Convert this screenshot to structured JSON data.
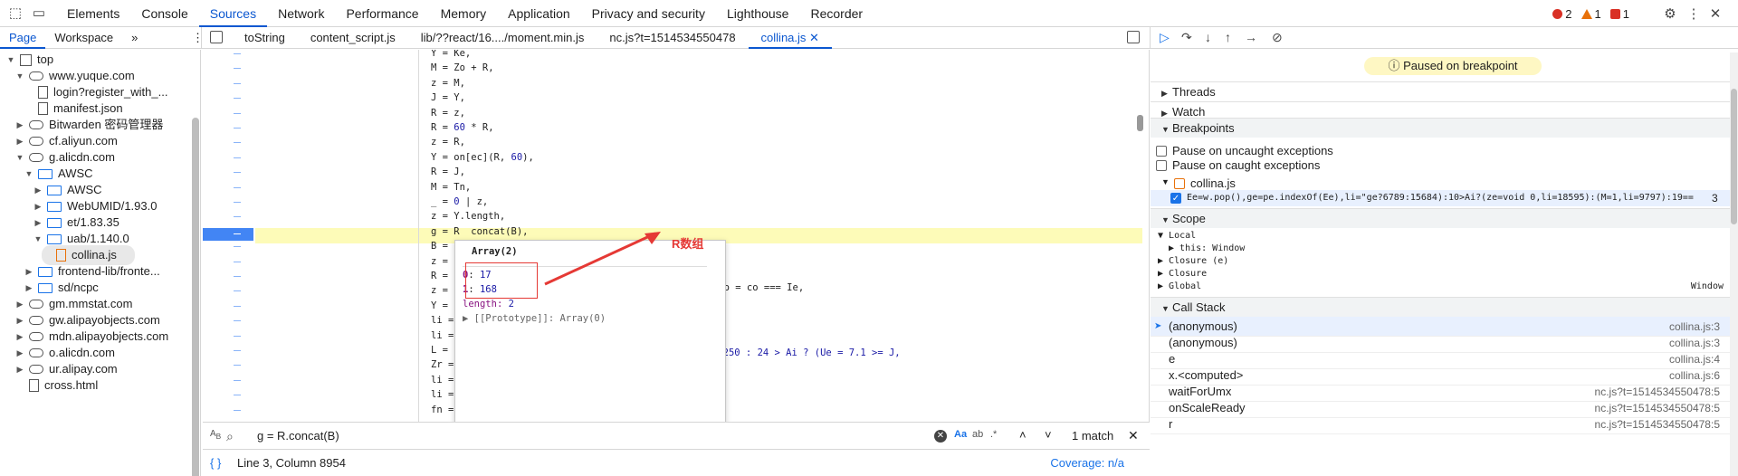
{
  "toolbar": {
    "tabs": [
      "Elements",
      "Console",
      "Sources",
      "Network",
      "Performance",
      "Memory",
      "Application",
      "Privacy and security",
      "Lighthouse",
      "Recorder"
    ],
    "errors": "2",
    "warnings": "1",
    "issues": "1"
  },
  "navigator": {
    "tabs": [
      "Page",
      "Workspace"
    ],
    "more": "»"
  },
  "file_tabs": [
    "toString",
    "content_script.js",
    "lib/??react/16..../moment.min.js",
    "nc.js?t=1514534550478",
    "collina.js"
  ],
  "tree": [
    {
      "label": "top",
      "indent": 0,
      "arrow": "▼",
      "icon": "top"
    },
    {
      "label": "www.yuque.com",
      "indent": 1,
      "arrow": "▼",
      "icon": "cloud"
    },
    {
      "label": "login?register_with_...",
      "indent": 2,
      "arrow": "",
      "icon": "file"
    },
    {
      "label": "manifest.json",
      "indent": 2,
      "arrow": "",
      "icon": "file"
    },
    {
      "label": "Bitwarden 密码管理器",
      "indent": 1,
      "arrow": "▶",
      "icon": "cloud"
    },
    {
      "label": "cf.aliyun.com",
      "indent": 1,
      "arrow": "▶",
      "icon": "cloud"
    },
    {
      "label": "g.alicdn.com",
      "indent": 1,
      "arrow": "▼",
      "icon": "cloud"
    },
    {
      "label": "AWSC",
      "indent": 2,
      "arrow": "▼",
      "icon": "folder"
    },
    {
      "label": "AWSC",
      "indent": 3,
      "arrow": "▶",
      "icon": "folder"
    },
    {
      "label": "WebUMID/1.93.0",
      "indent": 3,
      "arrow": "▶",
      "icon": "folder"
    },
    {
      "label": "et/1.83.35",
      "indent": 3,
      "arrow": "▶",
      "icon": "folder"
    },
    {
      "label": "uab/1.140.0",
      "indent": 3,
      "arrow": "▼",
      "icon": "folder"
    },
    {
      "label": "collina.js",
      "indent": 4,
      "arrow": "",
      "icon": "js",
      "selected": true
    },
    {
      "label": "frontend-lib/fronte...",
      "indent": 2,
      "arrow": "▶",
      "icon": "folder"
    },
    {
      "label": "sd/ncpc",
      "indent": 2,
      "arrow": "▶",
      "icon": "folder"
    },
    {
      "label": "gm.mmstat.com",
      "indent": 1,
      "arrow": "▶",
      "icon": "cloud"
    },
    {
      "label": "gw.alipayobjects.com",
      "indent": 1,
      "arrow": "▶",
      "icon": "cloud"
    },
    {
      "label": "mdn.alipayobjects.com",
      "indent": 1,
      "arrow": "▶",
      "icon": "cloud"
    },
    {
      "label": "o.alicdn.com",
      "indent": 1,
      "arrow": "▶",
      "icon": "cloud"
    },
    {
      "label": "ur.alipay.com",
      "indent": 1,
      "arrow": "▶",
      "icon": "cloud"
    },
    {
      "label": "cross.html",
      "indent": 1,
      "arrow": "",
      "icon": "file"
    }
  ],
  "code_lines": [
    "Y = Ke,",
    "M = Zo + R,",
    "z = M,",
    "J = Y,",
    "R = z,",
    "R = 60 * R,",
    "z = R,",
    "Y = on[ec](R, 60),",
    "R = J,",
    "M = Tn,",
    "_ = 0 | z,",
    "z = Y.length,",
    "g = R  concat(B),",
    "B =",
    "z =",
    "R =",
    "z =",
    "Y =",
    "li =",
    "li =",
    "L =",
    "Zr =",
    "li =",
    "li =",
    "fn ="
  ],
  "code_tail": {
    "line19": "(Jo = co === Ie,",
    "line23": "21250 : 24 > Ai ? (Ue = 7.1 >= J,"
  },
  "popup": {
    "title": "Array(2)",
    "item0_key": "0",
    "item0_val": "17",
    "item1_key": "1",
    "item1_val": "168",
    "length_key": "length",
    "length_val": "2",
    "proto": "[[Prototype]]: Array(0)"
  },
  "annotation": "R数组",
  "search": {
    "value": "g = R.concat(B)",
    "match_case": "Aa",
    "regex": ".*",
    "result": "1 match"
  },
  "status": {
    "position": "Line 3, Column 8954",
    "coverage": "Coverage: n/a"
  },
  "debugger": {
    "paused": "Paused on breakpoint",
    "threads": "Threads",
    "watch": "Watch",
    "breakpoints": "Breakpoints",
    "pause_uncaught": "Pause on uncaught exceptions",
    "pause_caught": "Pause on caught exceptions",
    "bp_file": "collina.js",
    "bp_code": "Ee=w.pop(),ge=pe.indexOf(Ee),li=\"ge?6789:15684):10>Ai?(ze=void 0,li=18595):(M=1,li=9797):19===",
    "bp_line": "3",
    "scope": "Scope",
    "local": "Local",
    "this_label": "this: Window",
    "closure_e": "Closure (e)",
    "closure": "Closure",
    "global": "Global",
    "global_val": "Window",
    "call_stack": "Call Stack",
    "frames": [
      {
        "fn": "(anonymous)",
        "loc": "collina.js:3"
      },
      {
        "fn": "(anonymous)",
        "loc": "collina.js:3"
      },
      {
        "fn": "e",
        "loc": "collina.js:4"
      },
      {
        "fn": "x.<computed>",
        "loc": "collina.js:6"
      },
      {
        "fn": "waitForUmx",
        "loc": "nc.js?t=1514534550478:5"
      },
      {
        "fn": "onScaleReady",
        "loc": "nc.js?t=1514534550478:5"
      },
      {
        "fn": "r",
        "loc": "nc.js?t=1514534550478:5"
      }
    ]
  }
}
